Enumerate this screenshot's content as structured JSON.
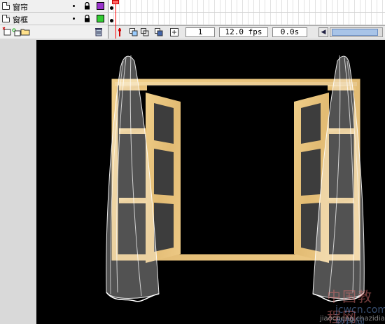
{
  "timeline": {
    "layers": [
      {
        "name": "窗帘",
        "color": "#9933cc"
      },
      {
        "name": "窗框",
        "color": "#33cc33"
      }
    ],
    "current_frame": "1",
    "frame_rate": "12.0 fps",
    "elapsed_time": "0.0s"
  },
  "watermark": {
    "line1": "中国教程网",
    "line2": "jcwcn.com 教程网",
    "line3": "jiaocheng.chazidian.com"
  },
  "icons": {
    "layer": "layer-icon",
    "lock": "lock-icon",
    "eye": "visibility-dot",
    "trash": "trash-icon",
    "add_layer": "add-layer-icon",
    "add_folder": "add-folder-icon",
    "onion_skin": "onion-skin-icon"
  },
  "colors": {
    "stage_background": "#000000",
    "window_frame": "#e8c47e",
    "window_pane": "#3a3a3a",
    "curtain": "#ffffff"
  }
}
